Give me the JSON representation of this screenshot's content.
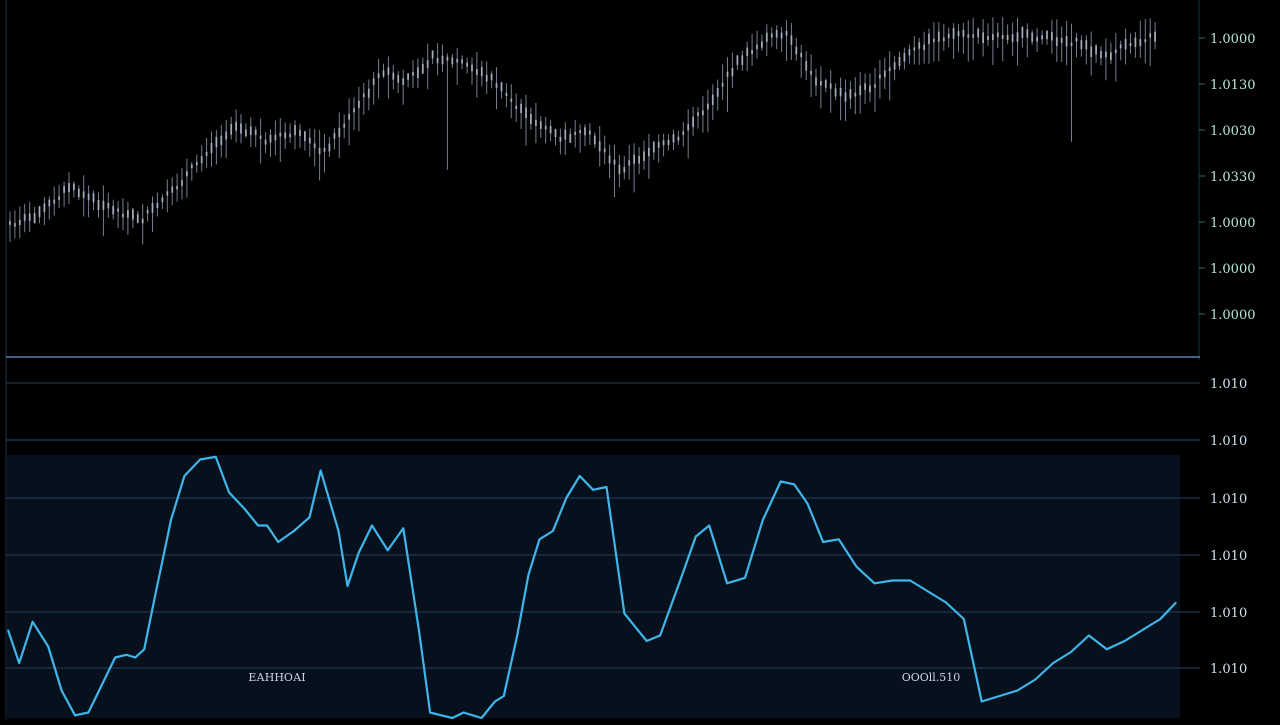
{
  "colors": {
    "background": "#000000",
    "price_wick": "#8a95a8",
    "price_body": "#a9b3c2",
    "oscillator_line": "#3fb6ea",
    "oscillator_panel": "#07111d",
    "divider": "#5a7fb6",
    "grid": "#23405f",
    "axis_text_price": "#b9e6da",
    "axis_text_osc": "#cfe3ee"
  },
  "price_axis": {
    "labels": [
      "1.0000",
      "1.0130",
      "1.0030",
      "1.0330",
      "1.0000",
      "1.0000",
      "1.0000"
    ]
  },
  "oscillator_axis": {
    "labels": [
      "1.010",
      "1.010",
      "1.010",
      "1.010",
      "1.010",
      "1.010"
    ]
  },
  "annotations": [
    {
      "name": "left-annotation",
      "text": "ЕАННОАI"
    },
    {
      "name": "right-annotation",
      "text": "ОООll.510"
    }
  ],
  "chart_data": [
    {
      "type": "candlestick",
      "title": "",
      "y_axis_side": "right",
      "grid": false,
      "series": [
        {
          "trend_points": [
            [
              0,
              0.28
            ],
            [
              6,
              0.32
            ],
            [
              12,
              0.42
            ],
            [
              17,
              0.37
            ],
            [
              22,
              0.33
            ],
            [
              27,
              0.3
            ],
            [
              33,
              0.4
            ],
            [
              40,
              0.55
            ],
            [
              46,
              0.65
            ],
            [
              52,
              0.59
            ],
            [
              58,
              0.62
            ],
            [
              64,
              0.55
            ],
            [
              70,
              0.7
            ],
            [
              76,
              0.85
            ],
            [
              80,
              0.8
            ],
            [
              86,
              0.9
            ],
            [
              92,
              0.88
            ],
            [
              98,
              0.82
            ],
            [
              104,
              0.7
            ],
            [
              112,
              0.6
            ],
            [
              118,
              0.62
            ],
            [
              124,
              0.48
            ],
            [
              130,
              0.55
            ],
            [
              136,
              0.6
            ],
            [
              142,
              0.72
            ],
            [
              148,
              0.88
            ],
            [
              154,
              0.97
            ],
            [
              158,
              0.98
            ],
            [
              164,
              0.82
            ],
            [
              170,
              0.75
            ],
            [
              176,
              0.8
            ],
            [
              182,
              0.9
            ],
            [
              188,
              0.97
            ],
            [
              194,
              0.98
            ],
            [
              200,
              0.98
            ],
            [
              206,
              0.98
            ],
            [
              212,
              0.97
            ],
            [
              218,
              0.95
            ],
            [
              223,
              0.9
            ],
            [
              228,
              0.95
            ],
            [
              233,
              0.98
            ]
          ]
        }
      ]
    },
    {
      "type": "line",
      "title": "",
      "y_axis_side": "right",
      "grid": true,
      "ylim": [
        0,
        100
      ],
      "series": [
        {
          "x": [
            0,
            5,
            11,
            18,
            24,
            30,
            36,
            42,
            48,
            53,
            57,
            61,
            66,
            73,
            79,
            86,
            93,
            99,
            106,
            112,
            116,
            121,
            128,
            135,
            140,
            148,
            152,
            157,
            163,
            170,
            177,
            184,
            189,
            194,
            199,
            204,
            212,
            218,
            222,
            228,
            233,
            238,
            244,
            250,
            256,
            262,
            268,
            276,
            286,
            292,
            301,
            308,
            314,
            322,
            330,
            338,
            346,
            352,
            358,
            365,
            372,
            380,
            388,
            396,
            404,
            412,
            420,
            428,
            436,
            444,
            452,
            460,
            468,
            476,
            484,
            492,
            500,
            508,
            516,
            523
          ],
          "values": [
            32,
            20,
            35,
            26,
            10,
            1,
            2,
            12,
            22,
            23,
            22,
            25,
            45,
            72,
            88,
            94,
            95,
            82,
            76,
            70,
            70,
            64,
            68,
            73,
            90,
            68,
            48,
            60,
            70,
            61,
            69,
            32,
            2,
            1,
            0,
            2,
            0,
            6,
            8,
            30,
            52,
            65,
            68,
            80,
            88,
            83,
            84,
            38,
            28,
            30,
            50,
            66,
            70,
            49,
            51,
            72,
            86,
            85,
            78,
            64,
            65,
            55,
            49,
            50,
            50,
            46,
            42,
            36,
            6,
            8,
            10,
            14,
            20,
            24,
            30,
            25,
            28,
            32,
            36,
            42
          ]
        }
      ]
    }
  ]
}
